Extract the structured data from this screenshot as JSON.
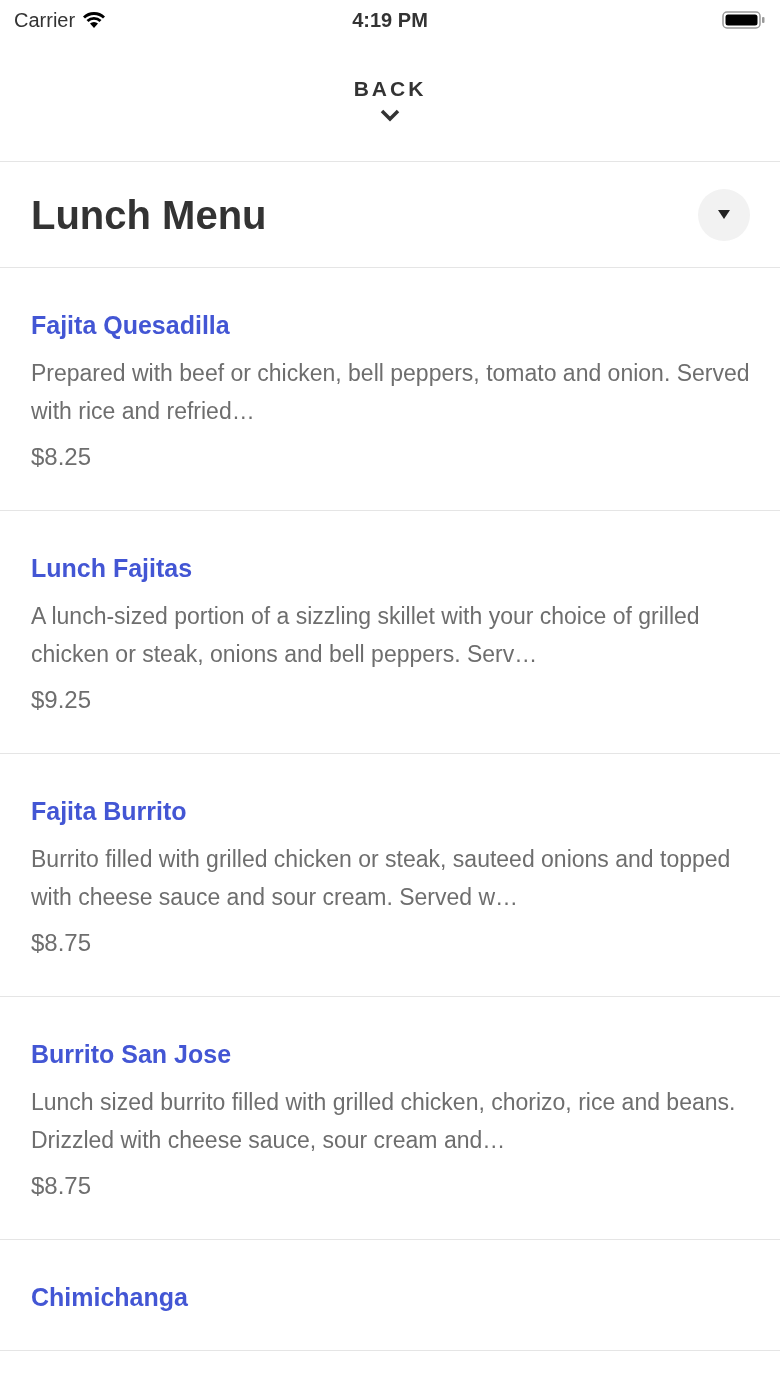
{
  "status_bar": {
    "carrier": "Carrier",
    "time": "4:19 PM"
  },
  "back": {
    "label": "BACK"
  },
  "header": {
    "title": "Lunch Menu"
  },
  "menu_items": [
    {
      "name": "Fajita Quesadilla",
      "description": "Prepared with beef or chicken, bell peppers, tomato and onion. Served with rice and refried…",
      "price": "$8.25"
    },
    {
      "name": "Lunch Fajitas",
      "description": "A lunch-sized portion of a sizzling skillet with your choice of grilled chicken or steak, onions and bell peppers. Serv…",
      "price": "$9.25"
    },
    {
      "name": "Fajita Burrito",
      "description": "Burrito filled with grilled chicken or steak, sauteed onions and topped with cheese sauce and sour cream. Served w…",
      "price": "$8.75"
    },
    {
      "name": "Burrito San Jose",
      "description": "Lunch sized burrito filled with grilled chicken, chorizo, rice and beans. Drizzled with cheese sauce, sour cream and…",
      "price": "$8.75"
    },
    {
      "name": "Chimichanga"
    }
  ]
}
